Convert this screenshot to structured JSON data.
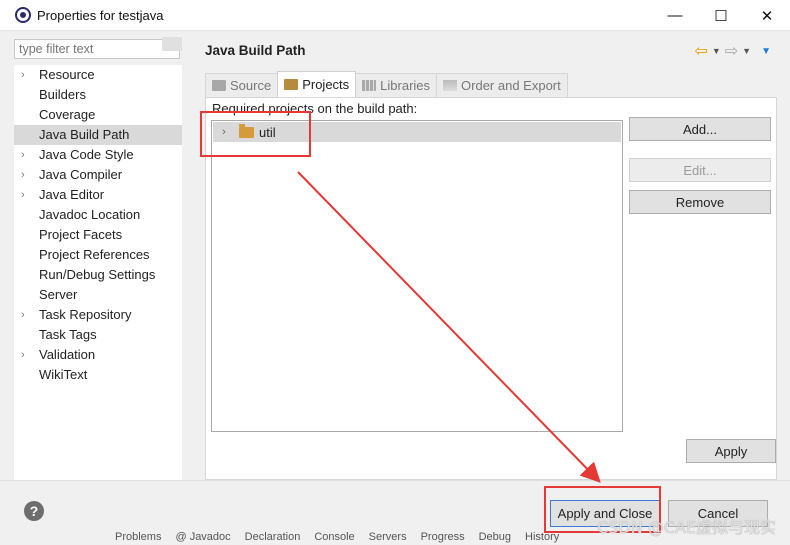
{
  "window": {
    "title": "Properties for testjava",
    "minimize": "—",
    "maximize": "☐",
    "close": "✕"
  },
  "filter": {
    "placeholder": "type filter text"
  },
  "sidebar": {
    "items": [
      {
        "label": "Resource",
        "expandable": true
      },
      {
        "label": "Builders",
        "expandable": false
      },
      {
        "label": "Coverage",
        "expandable": false
      },
      {
        "label": "Java Build Path",
        "expandable": false,
        "selected": true
      },
      {
        "label": "Java Code Style",
        "expandable": true
      },
      {
        "label": "Java Compiler",
        "expandable": true
      },
      {
        "label": "Java Editor",
        "expandable": true
      },
      {
        "label": "Javadoc Location",
        "expandable": false
      },
      {
        "label": "Project Facets",
        "expandable": false
      },
      {
        "label": "Project References",
        "expandable": false
      },
      {
        "label": "Run/Debug Settings",
        "expandable": false
      },
      {
        "label": "Server",
        "expandable": false
      },
      {
        "label": "Task Repository",
        "expandable": true
      },
      {
        "label": "Task Tags",
        "expandable": false
      },
      {
        "label": "Validation",
        "expandable": true
      },
      {
        "label": "WikiText",
        "expandable": false
      }
    ]
  },
  "panel": {
    "title": "Java Build Path",
    "tabs": [
      {
        "label": "Source",
        "active": false
      },
      {
        "label": "Projects",
        "active": true
      },
      {
        "label": "Libraries",
        "active": false
      },
      {
        "label": "Order and Export",
        "active": false
      }
    ],
    "required_label": "Required projects on the build path:",
    "projects": [
      {
        "name": "util"
      }
    ],
    "buttons": {
      "add": "Add...",
      "edit": "Edit...",
      "remove": "Remove",
      "apply": "Apply"
    }
  },
  "footer": {
    "help": "?",
    "apply_close": "Apply and Close",
    "cancel": "Cancel"
  },
  "taskbar": [
    "Problems",
    "@ Javadoc",
    "Declaration",
    "Console",
    "Servers",
    "Progress",
    "Debug",
    "History"
  ],
  "watermark": "CSDN @CAE虚拟与现实",
  "colors": {
    "annotation": "#e53935",
    "selection": "#d9d9d9"
  }
}
